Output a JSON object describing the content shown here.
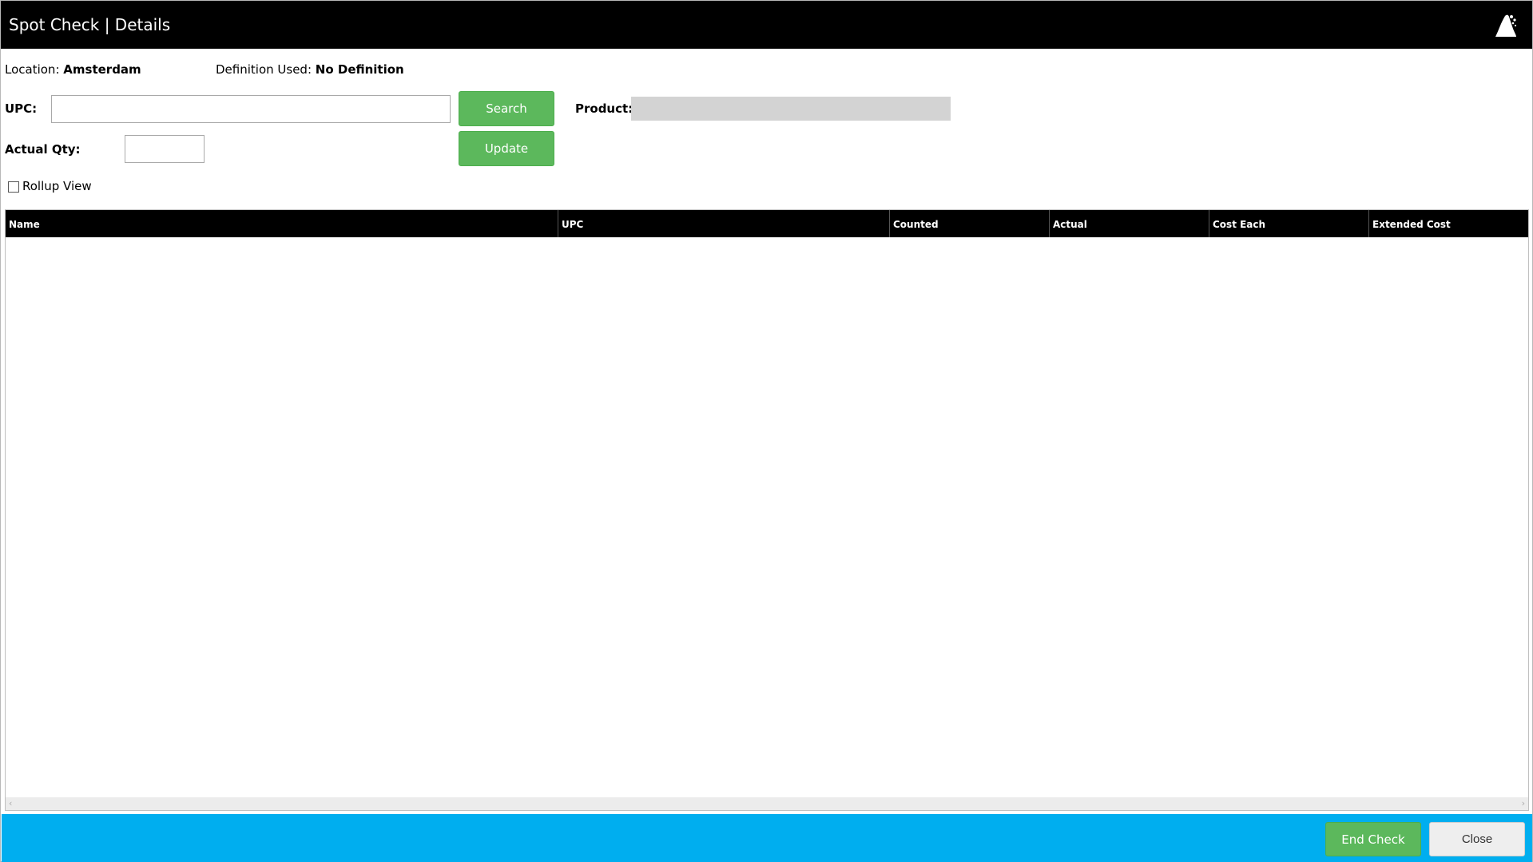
{
  "header": {
    "title": "Spot Check | Details",
    "logo_icon": "app-logo-icon"
  },
  "info": {
    "location_label": "Location:",
    "location_value": "Amsterdam",
    "definition_label": "Definition Used:",
    "definition_value": "No Definition"
  },
  "form": {
    "upc_label": "UPC:",
    "upc_value": "",
    "search_label": "Search",
    "product_label": "Product:",
    "product_value": "",
    "actual_qty_label": "Actual Qty:",
    "actual_qty_value": "",
    "update_label": "Update",
    "rollup_label": "Rollup View",
    "rollup_checked": false
  },
  "table": {
    "columns": [
      "Name",
      "UPC",
      "Counted",
      "Actual",
      "Cost Each",
      "Extended Cost"
    ],
    "rows": []
  },
  "footer": {
    "end_check_label": "End Check",
    "close_label": "Close"
  },
  "colors": {
    "header_bg": "#000000",
    "footer_bg": "#00aeef",
    "button_green": "#5cb85c",
    "product_box": "#d3d3d3"
  }
}
